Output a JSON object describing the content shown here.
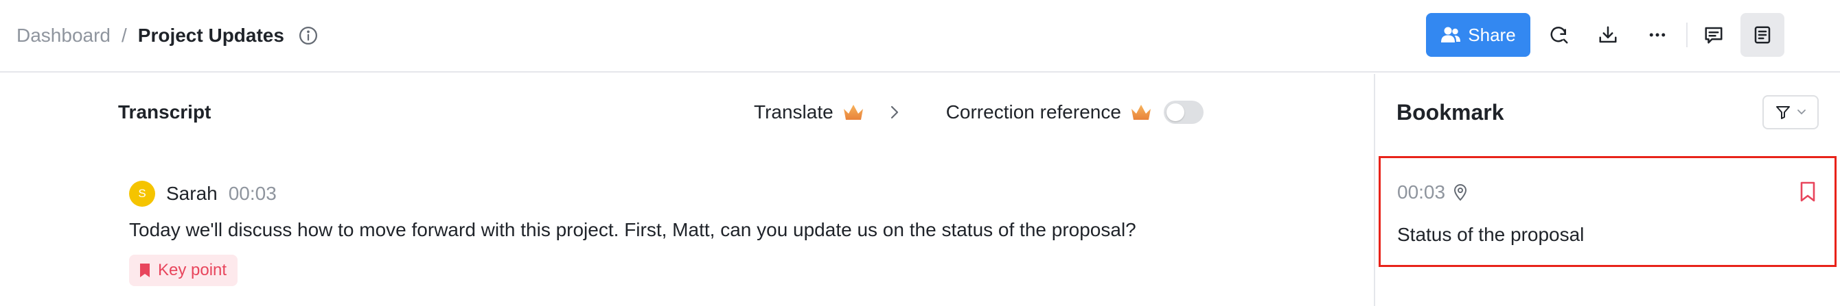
{
  "header": {
    "breadcrumb_parent": "Dashboard",
    "breadcrumb_separator": "/",
    "breadcrumb_current": "Project Updates",
    "share_label": "Share",
    "icons": [
      "info-icon",
      "users-icon",
      "search-refresh-icon",
      "download-icon",
      "more-icon",
      "comment-icon",
      "notes-icon"
    ]
  },
  "transcript": {
    "title": "Transcript",
    "translate_label": "Translate",
    "correction_label": "Correction reference",
    "correction_enabled": false,
    "entry": {
      "avatar_letter": "S",
      "speaker": "Sarah",
      "time": "00:03",
      "text": "Today we'll discuss how to move forward with this project. First, Matt, can you update us on the status of the proposal?",
      "tag": "Key point"
    }
  },
  "bookmark": {
    "title": "Bookmark",
    "items": [
      {
        "time": "00:03",
        "text": "Status of the proposal"
      }
    ]
  },
  "colors": {
    "accent": "#3388f1",
    "avatar": "#f5c400",
    "key_point_bg": "#fde9ec",
    "key_point_fg": "#e8455c",
    "highlight_border": "#e8231a",
    "crown": "#f0a04b"
  }
}
